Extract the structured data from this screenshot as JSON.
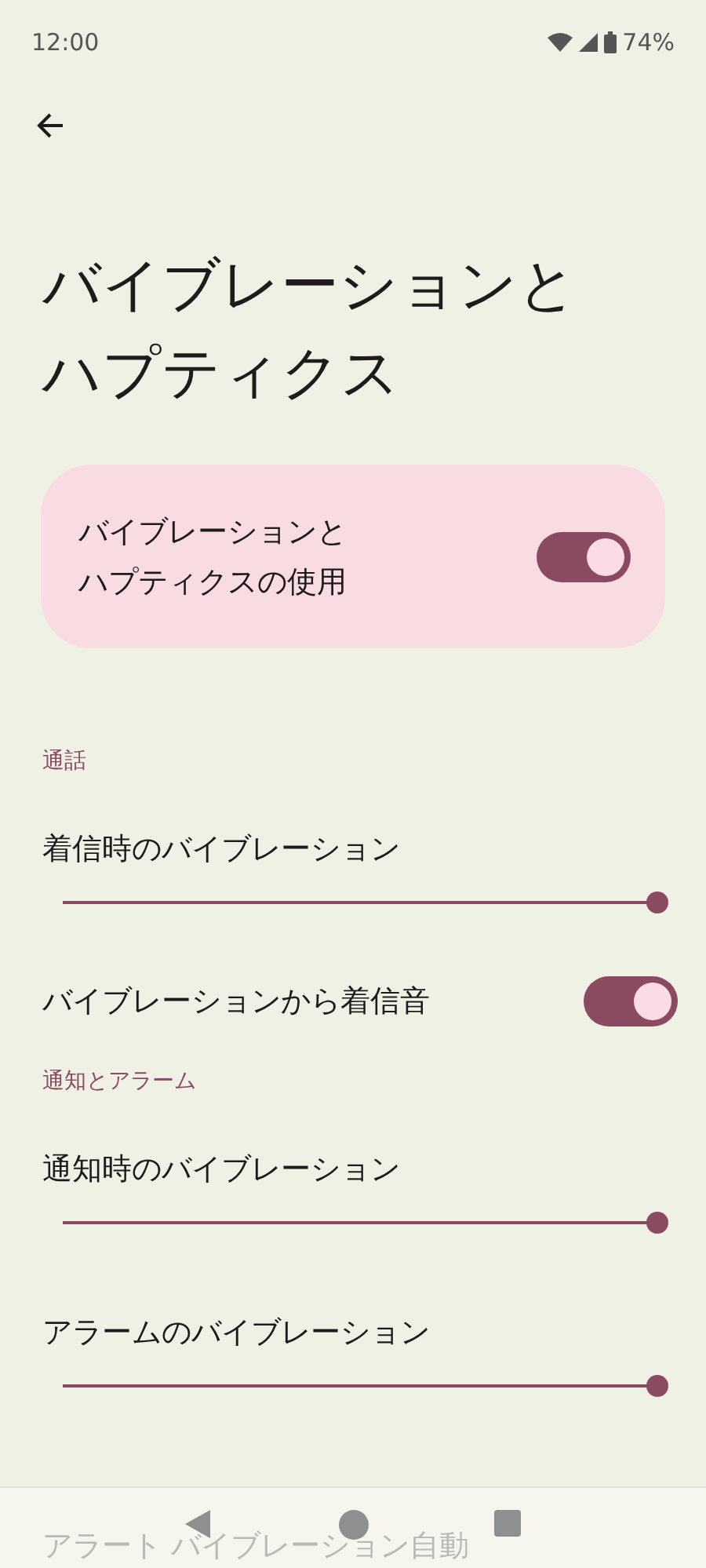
{
  "status_bar": {
    "time": "12:00",
    "battery": "74%"
  },
  "title": "バイブレーションとハプティクス",
  "main_switch": {
    "label": "バイブレーションとハプティクスの使用",
    "on": true
  },
  "sections": [
    {
      "header": "通話",
      "items": [
        {
          "kind": "slider",
          "label": "着信時のバイブレーション",
          "level": 1
        },
        {
          "kind": "toggle",
          "label": "バイブレーションから着信音",
          "on": true
        }
      ]
    },
    {
      "header": "通知とアラーム",
      "items": [
        {
          "kind": "slider",
          "label": "通知時のバイブレーション",
          "level": 1
        },
        {
          "kind": "slider",
          "label": "アラームのバイブレーション",
          "level": 1
        },
        {
          "kind": "partial",
          "label": "アラート バイブレーション自動"
        }
      ]
    }
  ]
}
